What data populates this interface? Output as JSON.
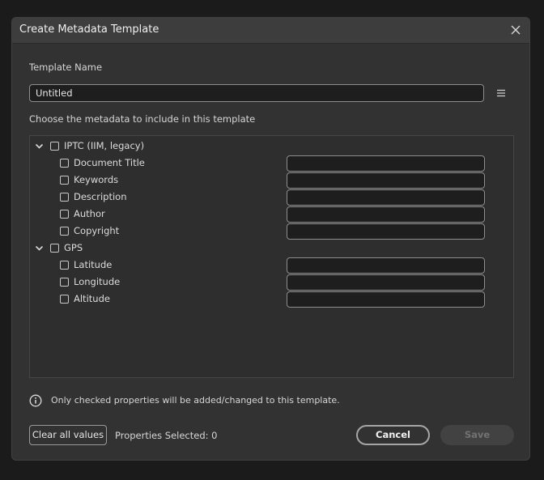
{
  "dialog": {
    "title": "Create Metadata Template",
    "template_name_label": "Template Name",
    "template_name_value": "Untitled",
    "choose_label": "Choose the metadata to include in this template",
    "info_text": "Only checked properties will be added/changed to this template.",
    "clear_button": "Clear all values",
    "properties_selected": "Properties Selected: 0",
    "cancel_button": "Cancel",
    "save_button": "Save"
  },
  "groups": [
    {
      "label": "IPTC (IIM, legacy)",
      "expanded": true,
      "checked": false,
      "items": [
        {
          "label": "Document Title",
          "checked": false,
          "value": ""
        },
        {
          "label": "Keywords",
          "checked": false,
          "value": ""
        },
        {
          "label": "Description",
          "checked": false,
          "value": ""
        },
        {
          "label": "Author",
          "checked": false,
          "value": ""
        },
        {
          "label": "Copyright",
          "checked": false,
          "value": ""
        }
      ]
    },
    {
      "label": "GPS",
      "expanded": true,
      "checked": false,
      "items": [
        {
          "label": "Latitude",
          "checked": false,
          "value": ""
        },
        {
          "label": "Longitude",
          "checked": false,
          "value": ""
        },
        {
          "label": "Altitude",
          "checked": false,
          "value": ""
        }
      ]
    }
  ],
  "icons": {
    "close": "close-icon",
    "menu": "hamburger-menu-icon",
    "chevron": "chevron-down-icon",
    "info": "info-icon"
  }
}
